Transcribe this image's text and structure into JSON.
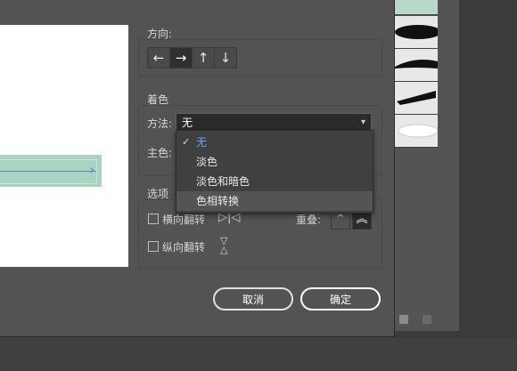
{
  "direction": {
    "title": "方向:",
    "buttons": [
      {
        "icon": "arrow-left-icon",
        "glyph": "←",
        "active": false
      },
      {
        "icon": "arrow-right-icon",
        "glyph": "→",
        "active": true
      },
      {
        "icon": "arrow-up-icon",
        "glyph": "↑",
        "active": false
      },
      {
        "icon": "arrow-down-icon",
        "glyph": "↓",
        "active": false
      }
    ]
  },
  "coloring": {
    "title": "着色",
    "method_label": "方法:",
    "method_value": "无",
    "main_color_label": "主色:",
    "dropdown_icon": "chevron-down-icon",
    "options": [
      {
        "label": "无",
        "selected": true
      },
      {
        "label": "淡色",
        "selected": false
      },
      {
        "label": "淡色和暗色",
        "selected": false
      },
      {
        "label": "色相转换",
        "selected": false,
        "hovered": true
      }
    ]
  },
  "options": {
    "title": "选项",
    "flip_horizontal_label": "横向翻转",
    "flip_vertical_label": "纵向翻转",
    "overlap_label": "重叠:"
  },
  "buttons": {
    "cancel": "取消",
    "ok": "确定"
  },
  "colors": {
    "dialog_bg": "#535353",
    "preview_stroke": "#a8d4c0",
    "path_line": "#5a7fd6",
    "selected_option": "#6aa6ff"
  }
}
